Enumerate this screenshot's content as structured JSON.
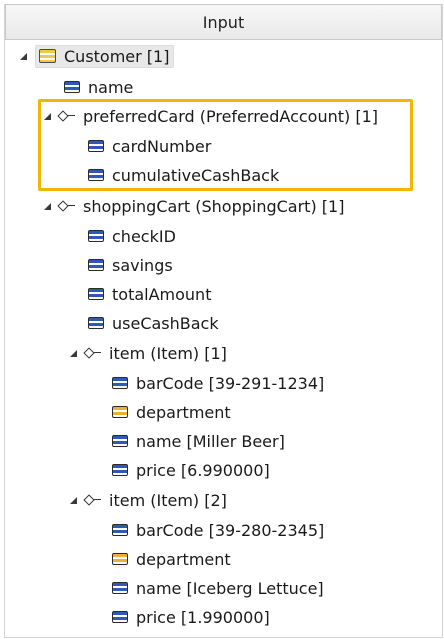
{
  "header": {
    "title": "Input"
  },
  "tree": {
    "root": {
      "label": "Customer [1]",
      "icon": "entity-icon"
    },
    "name": "name",
    "preferredCard": {
      "label": "preferredCard (PreferredAccount) [1]",
      "children": [
        "cardNumber",
        "cumulativeCashBack"
      ]
    },
    "shoppingCart": {
      "label": "shoppingCart (ShoppingCart) [1]",
      "fields": [
        "checkID",
        "savings",
        "totalAmount",
        "useCashBack"
      ],
      "items": [
        {
          "label": "item (Item) [1]",
          "fields": [
            "barCode [39-291-1234]",
            "department",
            "name [Miller Beer]",
            "price [6.990000]"
          ]
        },
        {
          "label": "item (Item) [2]",
          "fields": [
            "barCode [39-280-2345]",
            "department",
            "name [Iceberg Lettuce]",
            "price [1.990000]"
          ]
        }
      ]
    }
  },
  "colors": {
    "highlight": "#f5b400",
    "field_icon": "#2f58b7",
    "plain_field_icon": "#e9b233"
  }
}
